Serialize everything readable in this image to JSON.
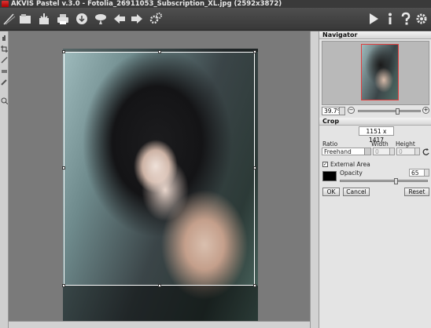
{
  "window": {
    "title": "AKVIS Pastel v.3.0 - Fotolia_26911053_Subscription_XL.jpg (2592x3872)"
  },
  "navigator": {
    "title": "Navigator",
    "zoom": "39.7%",
    "zoom_minus": "−",
    "zoom_plus": "+",
    "zoom_level": 0.65
  },
  "crop": {
    "title": "Crop",
    "size": "1151 x 1417",
    "ratio_label": "Ratio",
    "width_label": "Width",
    "height_label": "Height",
    "ratio_value": "Freehand",
    "width_value": "0",
    "height_value": "0",
    "external_area_label": "External Area",
    "external_area_checked": true,
    "opacity_label": "Opacity",
    "opacity_value": "65",
    "external_color": "#000000",
    "ok_label": "OK",
    "cancel_label": "Cancel",
    "reset_label": "Reset"
  },
  "toolbar": {
    "left_icons": [
      "brush-icon",
      "open-icon",
      "save-icon",
      "print-icon",
      "share-icon",
      "settings-plug-icon",
      "back-icon",
      "forward-icon",
      "gear-plugin-icon"
    ],
    "right_icons": [
      "run-icon",
      "info-icon",
      "help-icon",
      "preferences-icon"
    ]
  }
}
